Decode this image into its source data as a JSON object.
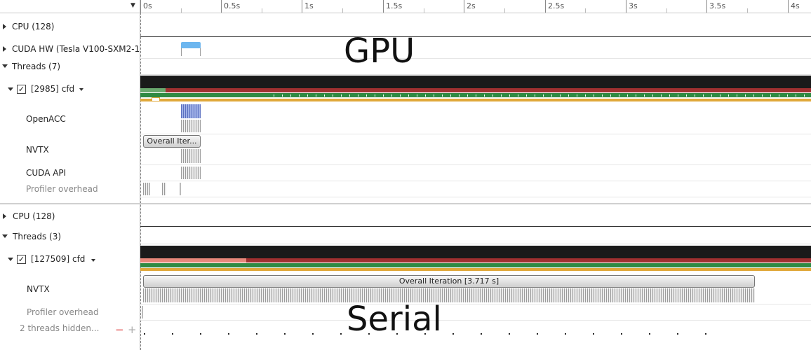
{
  "ruler": {
    "ticks": [
      "0s",
      "0.5s",
      "1s",
      "1.5s",
      "2s",
      "2.5s",
      "3s",
      "3.5s",
      "4s"
    ]
  },
  "top_panel": {
    "cpu_label": "CPU (128)",
    "cuda_hw_label": "CUDA HW (Tesla V100-SXM2-1",
    "threads_label": "Threads (7)",
    "process_label": "[2985] cfd",
    "openacc_label": "OpenACC",
    "nvtx_label": "NVTX",
    "nvtx_range": "Overall Iter...",
    "cuda_api_label": "CUDA API",
    "profiler_label": "Profiler overhead",
    "annotation": "GPU"
  },
  "bottom_panel": {
    "cpu_label": "CPU (128)",
    "threads_label": "Threads (3)",
    "process_label": "[127509] cfd",
    "nvtx_label": "NVTX",
    "nvtx_range": "Overall Iteration [3.717 s]",
    "profiler_label": "Profiler overhead",
    "hidden_threads": "2 threads hidden...",
    "annotation": "Serial"
  },
  "icons": {
    "checkbox": "✓",
    "minus": "−",
    "plus": "+"
  },
  "colors": {
    "thread_state_black": "#1a1a1a",
    "red_track": "#a03030",
    "green_track": "#2f8a43",
    "orange_track": "#e0a83a",
    "cuda_kernel_blue": "#6cb6ef",
    "remove_red": "#e04040"
  }
}
